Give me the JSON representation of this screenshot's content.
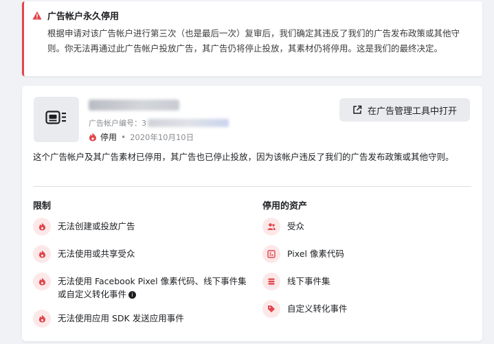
{
  "alert": {
    "title": "广告帐户永久停用",
    "body": "根据申请对该广告帐户进行第三次（也是最后一次）复审后，我们确定其违反了我们的广告发布政策或其他守则。你无法再通过此广告帐户投放广告，其广告仍将停止投放，其素材仍将停用。这是我们的最终决定。"
  },
  "account": {
    "id_label": "广告帐户编号：",
    "id_visible_prefix": "3",
    "status": "停用",
    "status_date": "2020年10月10日",
    "open_button_label": "在广告管理工具中打开"
  },
  "description": {
    "part1": "这个广告帐户及其广告素材已停用，其广告也已停止投放，因为该帐户违反了我们的",
    "link": "广告发布政策",
    "part2": "或其他守则。"
  },
  "restrictions": {
    "title": "限制",
    "items": [
      {
        "label": "无法创建或投放广告"
      },
      {
        "label": "无法使用或共享受众"
      },
      {
        "label": "无法使用 Facebook Pixel 像素代码、线下事件集或自定义转化事件"
      },
      {
        "label": "无法使用应用 SDK 发送应用事件"
      }
    ]
  },
  "disabled_assets": {
    "title": "停用的资产",
    "items": [
      {
        "label": "受众",
        "icon": "people-icon"
      },
      {
        "label": "Pixel 像素代码",
        "icon": "pixel-icon"
      },
      {
        "label": "线下事件集",
        "icon": "offline-events-icon"
      },
      {
        "label": "自定义转化事件",
        "icon": "tag-icon"
      }
    ]
  },
  "colors": {
    "danger": "#e0464c",
    "danger_bg": "#fce8e8",
    "muted_text": "#8a8d91"
  }
}
